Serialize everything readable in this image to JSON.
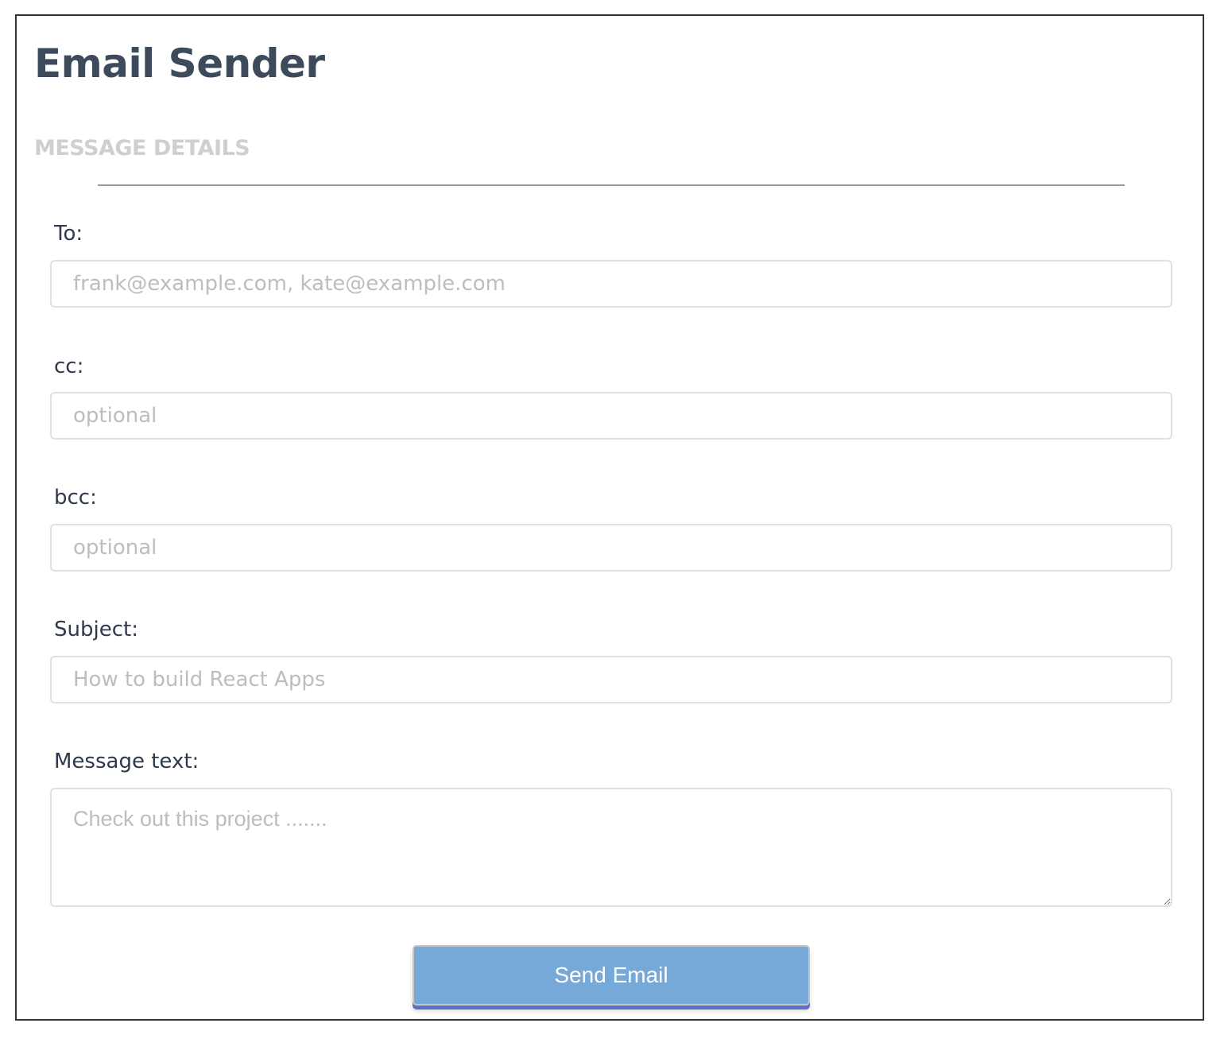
{
  "app": {
    "title": "Email Sender"
  },
  "section": {
    "title": "MESSAGE DETAILS"
  },
  "form": {
    "to": {
      "label": "To:",
      "placeholder": "frank@example.com, kate@example.com",
      "value": ""
    },
    "cc": {
      "label": "cc:",
      "placeholder": "optional",
      "value": ""
    },
    "bcc": {
      "label": "bcc:",
      "placeholder": "optional",
      "value": ""
    },
    "subject": {
      "label": "Subject:",
      "placeholder": "How to build React Apps",
      "value": ""
    },
    "message": {
      "label": "Message text:",
      "placeholder": "Check out this project .......",
      "value": ""
    },
    "submit_label": "Send Email"
  },
  "colors": {
    "title": "#3d4a5c",
    "section_title": "#cfcfcf",
    "label": "#2e3a4c",
    "placeholder": "#bdbdbd",
    "button_bg": "#76a9d8",
    "button_shadow": "#5e6fc8"
  }
}
